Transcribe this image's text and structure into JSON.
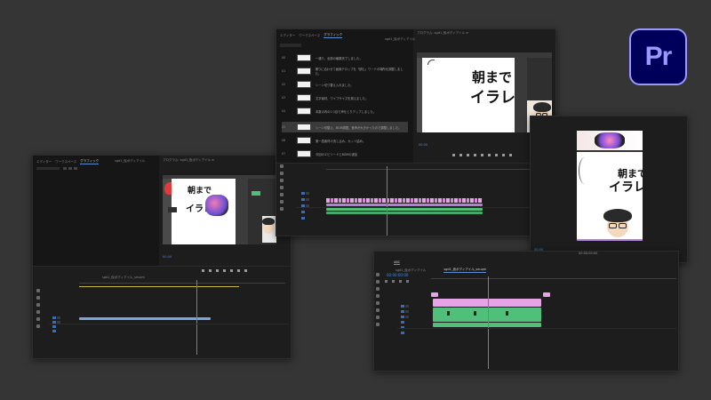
{
  "logo": {
    "text": "Pr",
    "bg": "#00005b",
    "fg": "#9999ff"
  },
  "windows": {
    "left": {
      "tabs": [
        "エディター",
        "ワークスペース",
        "グラフィック"
      ],
      "project_label": "sgd1_仮ボディアイル",
      "preview_title": "プログラム: sgd1_仮ボディアイル ≡",
      "timeline_tab": "sgd1_仮ボディアイル_seuqm"
    },
    "center": {
      "tabs": [
        "エディター",
        "ワークスペース",
        "グラフィック"
      ],
      "project_label": "sgd1_仮ボディアイル",
      "preview_title": "プログラム: sgd1_仮ボディアイル ≡",
      "history": [
        {
          "num": "00",
          "text": "一通り、全部の編集完了しました。"
        },
        {
          "num": "01",
          "text": "喋りに合わせて画像テロップを「読む」ワードの場所を調整しました。"
        },
        {
          "num": "02",
          "text": "シーン切り替え入れました。"
        },
        {
          "num": "03",
          "text": "文字素材、ワイプサイズを揃えました。"
        },
        {
          "num": "04",
          "text": "本数の内の1つ目で声をとりアップしました。"
        },
        {
          "num": "05",
          "text": "シーン切替え、BGM調整。音声が大きかったので調整しました。"
        },
        {
          "num": "06",
          "text": "第一週素材の流し込み、カット詰め。"
        },
        {
          "num": "07",
          "text": "今回のエピソードとBGMの追加"
        }
      ]
    },
    "right": {
      "tab": "ABC",
      "seq_tabs": [
        "sgd1_仮ボディアイル",
        "sgd1_仮ボディアイル_seuqm"
      ],
      "timecode": "00:00:00:00"
    }
  },
  "artwork": {
    "line1": "朝まで",
    "line2": "イラレ"
  }
}
